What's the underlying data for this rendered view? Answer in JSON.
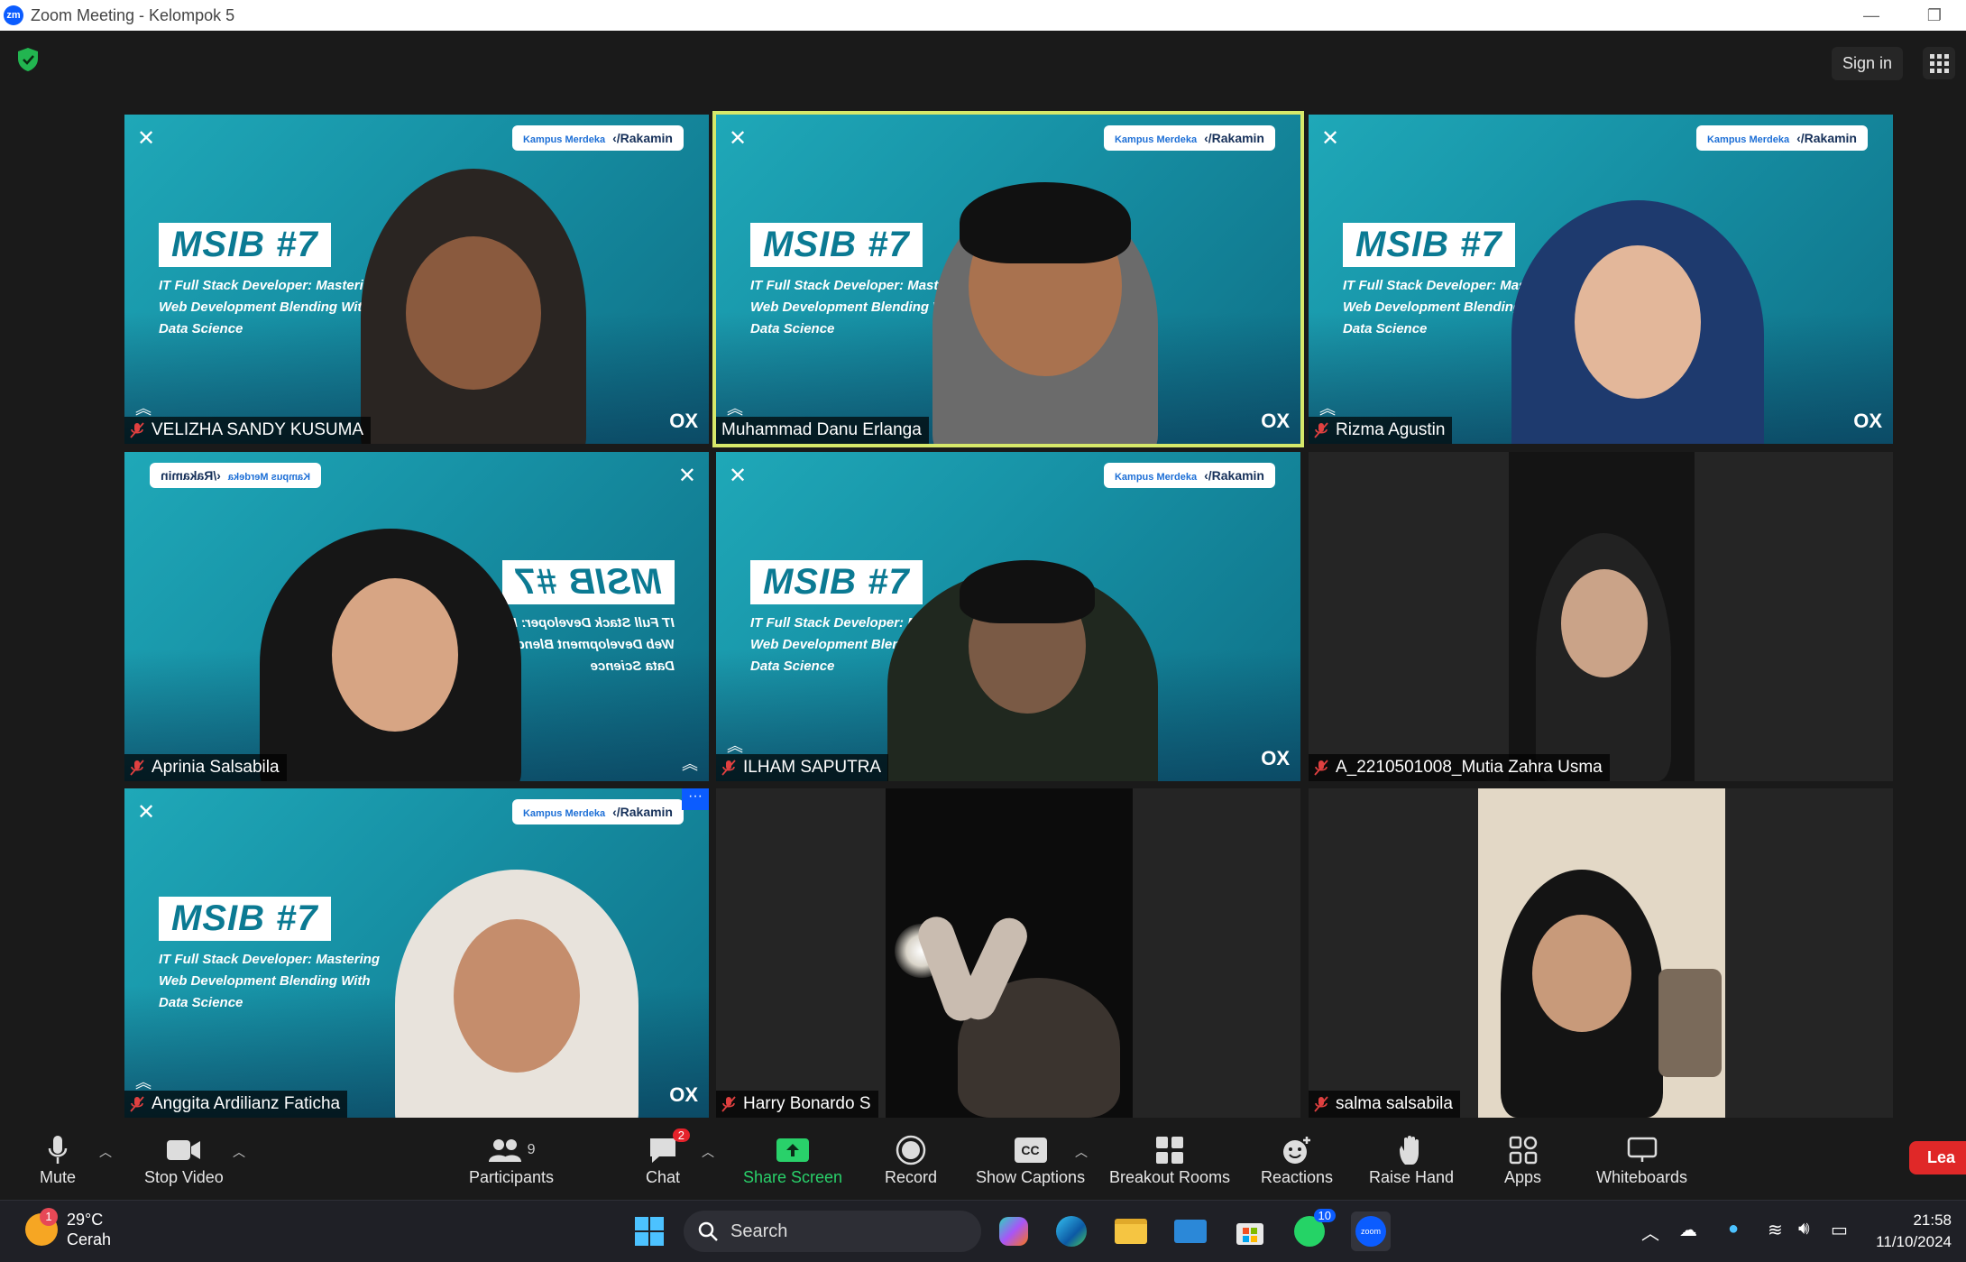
{
  "window": {
    "title": "Zoom Meeting - Kelompok 5",
    "logo": "zm"
  },
  "topbar": {
    "signin_label": "Sign in"
  },
  "background_text": {
    "msib": "MSIB #7",
    "line1": "IT Full Stack Developer: Mastering",
    "line2": "Web Development Blending With",
    "line3": "Data Science",
    "brand_left": "Kampus Merdeka",
    "brand_right": "‹/Rakamin"
  },
  "participants": [
    {
      "name": "VELIZHA SANDY KUSUMA"
    },
    {
      "name": "Muhammad Danu Erlanga"
    },
    {
      "name": "Rizma Agustin"
    },
    {
      "name": "Aprinia Salsabila"
    },
    {
      "name": "ILHAM SAPUTRA"
    },
    {
      "name": "A_2210501008_Mutia Zahra Usma"
    },
    {
      "name": "Anggita Ardilianz Faticha"
    },
    {
      "name": "Harry Bonardo S"
    },
    {
      "name": "salma salsabila"
    }
  ],
  "toolbar": {
    "mute": "Mute",
    "stop_video": "Stop Video",
    "participants": "Participants",
    "participants_count": "9",
    "chat": "Chat",
    "chat_badge": "2",
    "share_screen": "Share Screen",
    "record": "Record",
    "show_captions": "Show Captions",
    "cc": "CC",
    "breakout_rooms": "Breakout Rooms",
    "reactions": "Reactions",
    "raise_hand": "Raise Hand",
    "apps": "Apps",
    "whiteboards": "Whiteboards",
    "leave": "Lea"
  },
  "taskbar": {
    "weather_temp": "29°C",
    "weather_desc": "Cerah",
    "weather_badge": "1",
    "search_placeholder": "Search",
    "whatsapp_badge": "10",
    "zoom_label": "zoom",
    "time": "21:58",
    "date": "11/10/2024"
  },
  "colors": {
    "accent": "#0b5cff",
    "active_speaker": "#d6e86a",
    "share_green": "#29d16a",
    "leave_red": "#e02828"
  }
}
